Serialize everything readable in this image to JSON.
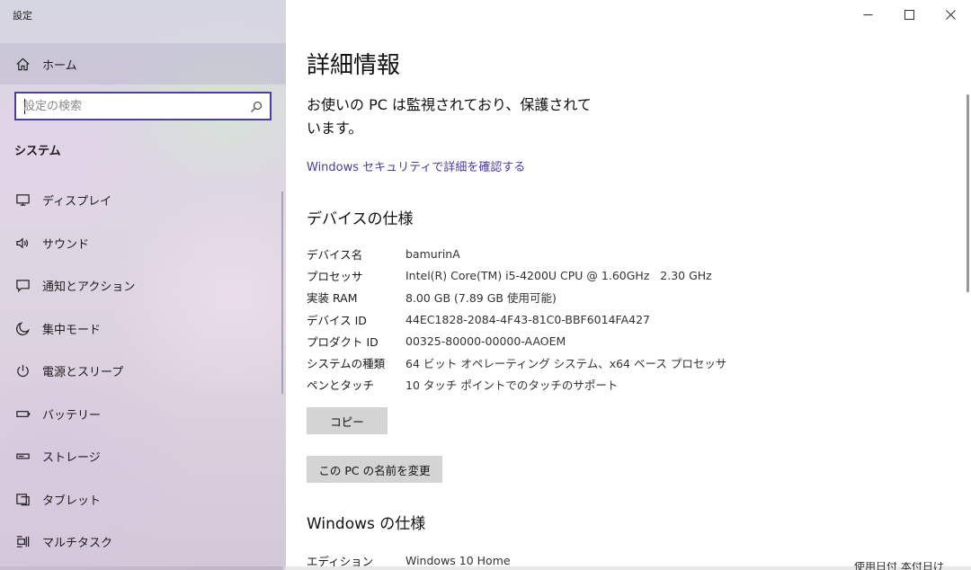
{
  "window": {
    "title": "設定",
    "controls": [
      "minimize-icon",
      "maximize-icon",
      "close-icon"
    ]
  },
  "sidebar": {
    "home_label": "ホーム",
    "search_placeholder": "設定の検索",
    "section_title": "システム",
    "items": [
      {
        "label": "ディスプレイ",
        "icon": "display-icon"
      },
      {
        "label": "サウンド",
        "icon": "sound-icon"
      },
      {
        "label": "通知とアクション",
        "icon": "notification-icon"
      },
      {
        "label": "集中モード",
        "icon": "moon-icon"
      },
      {
        "label": "電源とスリープ",
        "icon": "power-icon"
      },
      {
        "label": "バッテリー",
        "icon": "battery-icon"
      },
      {
        "label": "ストレージ",
        "icon": "storage-icon"
      },
      {
        "label": "タブレット",
        "icon": "tablet-icon"
      },
      {
        "label": "マルチタスク",
        "icon": "multitask-icon"
      }
    ]
  },
  "main": {
    "title": "詳細情報",
    "protection_text": "お使いの PC は監視されており、保護されています。",
    "security_link": "Windows セキュリティで詳細を確認する",
    "device_specs_title": "デバイスの仕様",
    "device_specs": [
      {
        "key": "デバイス名",
        "value": "bamurinA"
      },
      {
        "key": "プロセッサ",
        "value": "Intel(R) Core(TM) i5-4200U CPU @ 1.60GHz   2.30 GHz"
      },
      {
        "key": "実装 RAM",
        "value": "8.00 GB (7.89 GB 使用可能)"
      },
      {
        "key": "デバイス ID",
        "value": "44EC1828-2084-4F43-81C0-BBF6014FA427"
      },
      {
        "key": "プロダクト ID",
        "value": "00325-80000-00000-AAOEM"
      },
      {
        "key": "システムの種類",
        "value": "64 ビット オペレーティング システム、x64 ベース プロセッサ"
      },
      {
        "key": "ペンとタッチ",
        "value": "10 タッチ ポイントでのタッチのサポート"
      }
    ],
    "copy_button": "コピー",
    "rename_button": "この PC の名前を変更",
    "windows_specs_title": "Windows の仕様",
    "windows_specs": [
      {
        "key": "エディション",
        "value": "Windows 10 Home"
      }
    ],
    "corner_fragment": "使用日付 本付日け"
  },
  "colors": {
    "accent": "#4b3ea3",
    "link": "#4a3aa0",
    "button_bg": "#d4d4d4",
    "sidebar_highlight": "#bebace"
  }
}
